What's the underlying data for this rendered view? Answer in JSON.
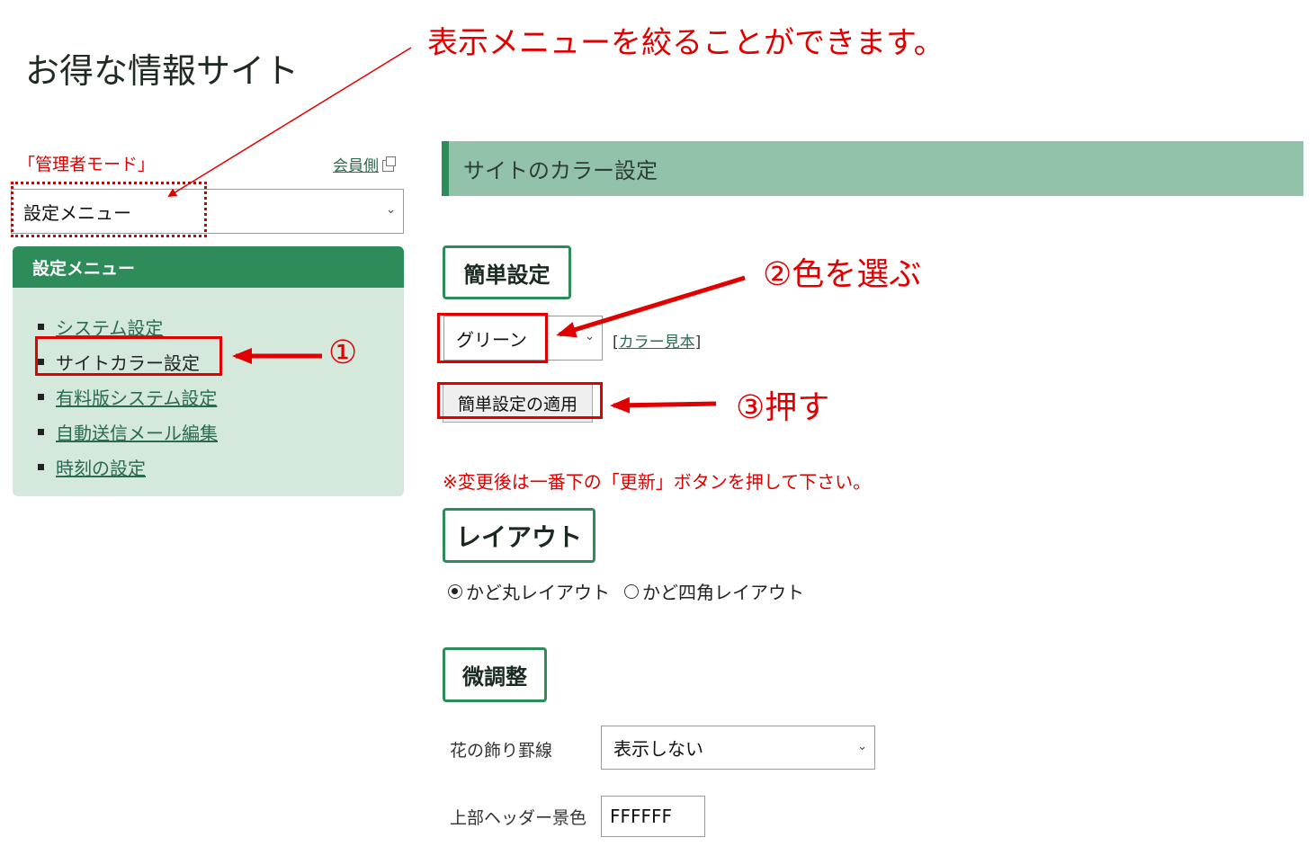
{
  "site": {
    "title": "お得な情報サイト"
  },
  "annotations": {
    "top": "表示メニューを絞ることができます。",
    "step1": "①",
    "step2": "②色を選ぶ",
    "step3": "③押す"
  },
  "sidebar": {
    "admin_mode": "「管理者モード」",
    "member_link": "会員側",
    "menu_select": {
      "value": "設定メニュー"
    },
    "panel_title": "設定メニュー",
    "items": [
      {
        "label": "システム設定",
        "active": false
      },
      {
        "label": "サイトカラー設定",
        "active": true
      },
      {
        "label": "有料版システム設定",
        "active": false
      },
      {
        "label": "自動送信メール編集",
        "active": false
      },
      {
        "label": "時刻の設定",
        "active": false
      }
    ]
  },
  "main": {
    "section_title": "サイトのカラー設定",
    "easy": {
      "heading": "簡単設定",
      "color_value": "グリーン",
      "swatch_open": "[",
      "swatch_link": "カラー見本",
      "swatch_close": "]",
      "apply_button": "簡単設定の適用"
    },
    "notice": "※変更後は一番下の「更新」ボタンを押して下さい。",
    "layout": {
      "heading": "レイアウト",
      "options": [
        {
          "label": "かど丸レイアウト",
          "checked": true
        },
        {
          "label": "かど四角レイアウト",
          "checked": false
        }
      ]
    },
    "fine": {
      "heading": "微調整",
      "flower_label": "花の飾り罫線",
      "flower_value": "表示しない",
      "header_color_label": "上部ヘッダー景色",
      "header_color_value": "FFFFFF"
    }
  },
  "colors": {
    "accent": "#2e8b5a",
    "annotation": "#e00000",
    "section_bg": "#93c2ab",
    "panel_bg": "#d4e8dc"
  }
}
